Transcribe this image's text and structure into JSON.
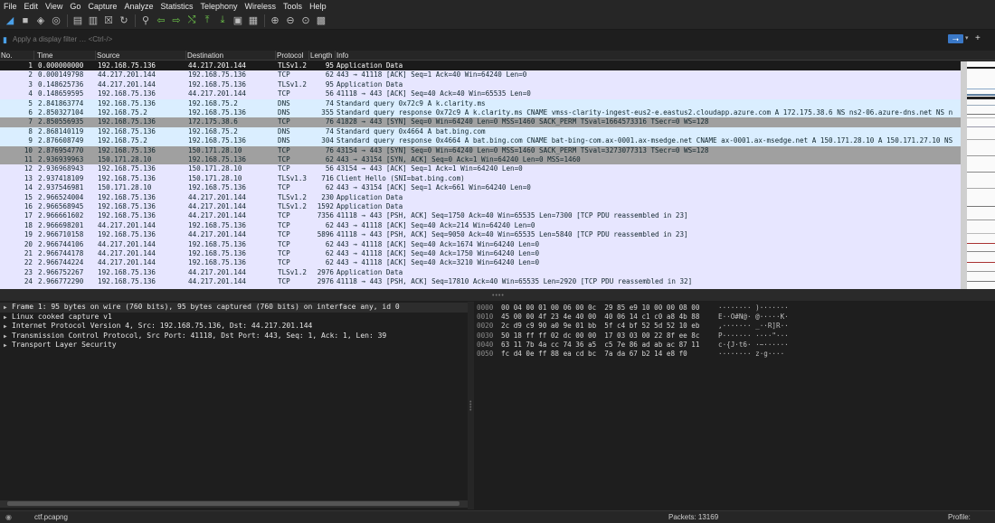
{
  "menu": [
    "File",
    "Edit",
    "View",
    "Go",
    "Capture",
    "Analyze",
    "Statistics",
    "Telephony",
    "Wireless",
    "Tools",
    "Help"
  ],
  "toolbar_icons": [
    "shark-fin-start-icon",
    "stop-icon",
    "restart-icon",
    "options-gear-icon",
    "open-file-icon",
    "save-file-icon",
    "close-file-icon",
    "reload-icon",
    "find-icon",
    "go-back-icon",
    "go-forward-icon",
    "go-to-packet-icon",
    "go-first-icon",
    "go-last-icon",
    "autoscroll-icon",
    "colorize-icon",
    "zoom-in-icon",
    "zoom-out-icon",
    "zoom-normal-icon",
    "resize-columns-icon"
  ],
  "filter": {
    "placeholder": "Apply a display filter … <Ctrl-/>",
    "apply_symbol": "⭢",
    "dropdown_symbol": "▾",
    "plus_symbol": "+"
  },
  "columns": [
    "No.",
    "Time",
    "Source",
    "Destination",
    "Protocol",
    "Length",
    "Info"
  ],
  "packets": [
    {
      "no": "1",
      "time": "0.000000000",
      "src": "192.168.75.136",
      "dst": "44.217.201.144",
      "proto": "TLSv1.2",
      "len": "95",
      "info": "Application Data",
      "style": "sel"
    },
    {
      "no": "2",
      "time": "0.000149798",
      "src": "44.217.201.144",
      "dst": "192.168.75.136",
      "proto": "TCP",
      "len": "62",
      "info": "443 → 41118 [ACK] Seq=1 Ack=40 Win=64240 Len=0",
      "style": "def"
    },
    {
      "no": "3",
      "time": "0.148625736",
      "src": "44.217.201.144",
      "dst": "192.168.75.136",
      "proto": "TLSv1.2",
      "len": "95",
      "info": "Application Data",
      "style": "def"
    },
    {
      "no": "4",
      "time": "0.148659595",
      "src": "192.168.75.136",
      "dst": "44.217.201.144",
      "proto": "TCP",
      "len": "56",
      "info": "41118 → 443 [ACK] Seq=40 Ack=40 Win=65535 Len=0",
      "style": "def"
    },
    {
      "no": "5",
      "time": "2.841863774",
      "src": "192.168.75.136",
      "dst": "192.168.75.2",
      "proto": "DNS",
      "len": "74",
      "info": "Standard query 0x72c9 A k.clarity.ms",
      "style": "ltblue"
    },
    {
      "no": "6",
      "time": "2.850327104",
      "src": "192.168.75.2",
      "dst": "192.168.75.136",
      "proto": "DNS",
      "len": "355",
      "info": "Standard query response 0x72c9 A k.clarity.ms CNAME vmss-clarity-ingest-eus2-e.eastus2.cloudapp.azure.com A 172.175.38.6 NS ns2-06.azure-dns.net NS n",
      "style": "ltblue"
    },
    {
      "no": "7",
      "time": "2.850556935",
      "src": "192.168.75.136",
      "dst": "172.175.38.6",
      "proto": "TCP",
      "len": "76",
      "info": "41828 → 443 [SYN] Seq=0 Win=64240 Len=0 MSS=1460 SACK_PERM TSval=1664573316 TSecr=0 WS=128",
      "style": "gray"
    },
    {
      "no": "8",
      "time": "2.868140119",
      "src": "192.168.75.136",
      "dst": "192.168.75.2",
      "proto": "DNS",
      "len": "74",
      "info": "Standard query 0x4664 A bat.bing.com",
      "style": "ltblue"
    },
    {
      "no": "9",
      "time": "2.876608749",
      "src": "192.168.75.2",
      "dst": "192.168.75.136",
      "proto": "DNS",
      "len": "304",
      "info": "Standard query response 0x4664 A bat.bing.com CNAME bat-bing-com.ax-0001.ax-msedge.net CNAME ax-0001.ax-msedge.net A 150.171.28.10 A 150.171.27.10 NS",
      "style": "ltblue"
    },
    {
      "no": "10",
      "time": "2.876954770",
      "src": "192.168.75.136",
      "dst": "150.171.28.10",
      "proto": "TCP",
      "len": "76",
      "info": "43154 → 443 [SYN] Seq=0 Win=64240 Len=0 MSS=1460 SACK_PERM TSval=3273077313 TSecr=0 WS=128",
      "style": "gray"
    },
    {
      "no": "11",
      "time": "2.936939963",
      "src": "150.171.28.10",
      "dst": "192.168.75.136",
      "proto": "TCP",
      "len": "62",
      "info": "443 → 43154 [SYN, ACK] Seq=0 Ack=1 Win=64240 Len=0 MSS=1460",
      "style": "gray"
    },
    {
      "no": "12",
      "time": "2.936968943",
      "src": "192.168.75.136",
      "dst": "150.171.28.10",
      "proto": "TCP",
      "len": "56",
      "info": "43154 → 443 [ACK] Seq=1 Ack=1 Win=64240 Len=0",
      "style": "def"
    },
    {
      "no": "13",
      "time": "2.937418109",
      "src": "192.168.75.136",
      "dst": "150.171.28.10",
      "proto": "TLSv1.3",
      "len": "716",
      "info": "Client Hello (SNI=bat.bing.com)",
      "style": "def"
    },
    {
      "no": "14",
      "time": "2.937546981",
      "src": "150.171.28.10",
      "dst": "192.168.75.136",
      "proto": "TCP",
      "len": "62",
      "info": "443 → 43154 [ACK] Seq=1 Ack=661 Win=64240 Len=0",
      "style": "def"
    },
    {
      "no": "15",
      "time": "2.966524004",
      "src": "192.168.75.136",
      "dst": "44.217.201.144",
      "proto": "TLSv1.2",
      "len": "230",
      "info": "Application Data",
      "style": "def"
    },
    {
      "no": "16",
      "time": "2.966568945",
      "src": "192.168.75.136",
      "dst": "44.217.201.144",
      "proto": "TLSv1.2",
      "len": "1592",
      "info": "Application Data",
      "style": "def"
    },
    {
      "no": "17",
      "time": "2.966661602",
      "src": "192.168.75.136",
      "dst": "44.217.201.144",
      "proto": "TCP",
      "len": "7356",
      "info": "41118 → 443 [PSH, ACK] Seq=1750 Ack=40 Win=65535 Len=7300 [TCP PDU reassembled in 23]",
      "style": "def"
    },
    {
      "no": "18",
      "time": "2.966698201",
      "src": "44.217.201.144",
      "dst": "192.168.75.136",
      "proto": "TCP",
      "len": "62",
      "info": "443 → 41118 [ACK] Seq=40 Ack=214 Win=64240 Len=0",
      "style": "def"
    },
    {
      "no": "19",
      "time": "2.966710158",
      "src": "192.168.75.136",
      "dst": "44.217.201.144",
      "proto": "TCP",
      "len": "5896",
      "info": "41118 → 443 [PSH, ACK] Seq=9050 Ack=40 Win=65535 Len=5840 [TCP PDU reassembled in 23]",
      "style": "def"
    },
    {
      "no": "20",
      "time": "2.966744106",
      "src": "44.217.201.144",
      "dst": "192.168.75.136",
      "proto": "TCP",
      "len": "62",
      "info": "443 → 41118 [ACK] Seq=40 Ack=1674 Win=64240 Len=0",
      "style": "def"
    },
    {
      "no": "21",
      "time": "2.966744178",
      "src": "44.217.201.144",
      "dst": "192.168.75.136",
      "proto": "TCP",
      "len": "62",
      "info": "443 → 41118 [ACK] Seq=40 Ack=1750 Win=64240 Len=0",
      "style": "def"
    },
    {
      "no": "22",
      "time": "2.966744224",
      "src": "44.217.201.144",
      "dst": "192.168.75.136",
      "proto": "TCP",
      "len": "62",
      "info": "443 → 41118 [ACK] Seq=40 Ack=3210 Win=64240 Len=0",
      "style": "def"
    },
    {
      "no": "23",
      "time": "2.966752267",
      "src": "192.168.75.136",
      "dst": "44.217.201.144",
      "proto": "TLSv1.2",
      "len": "2976",
      "info": "Application Data",
      "style": "def"
    },
    {
      "no": "24",
      "time": "2.966772290",
      "src": "192.168.75.136",
      "dst": "44.217.201.144",
      "proto": "TCP",
      "len": "2976",
      "info": "41118 → 443 [PSH, ACK] Seq=17810 Ack=40 Win=65535 Len=2920 [TCP PDU reassembled in 32]",
      "style": "def"
    }
  ],
  "details": [
    "Frame 1: 95 bytes on wire (760 bits), 95 bytes captured (760 bits) on interface any, id 0",
    "Linux cooked capture v1",
    "Internet Protocol Version 4, Src: 192.168.75.136, Dst: 44.217.201.144",
    "Transmission Control Protocol, Src Port: 41118, Dst Port: 443, Seq: 1, Ack: 1, Len: 39",
    "Transport Layer Security"
  ],
  "hex": [
    {
      "off": "0000",
      "bytes": "00 04 00 01 00 06 00 0c  29 85 e9 10 00 00 08 00",
      "ascii": "········ )·······"
    },
    {
      "off": "0010",
      "bytes": "45 00 00 4f 23 4e 40 00  40 06 14 c1 c0 a8 4b 88",
      "ascii": "E··O#N@· @·····K·"
    },
    {
      "off": "0020",
      "bytes": "2c d9 c9 90 a0 9e 01 bb  5f c4 bf 52 5d 52 10 eb",
      "ascii": ",······· _··R]R··"
    },
    {
      "off": "0030",
      "bytes": "50 18 ff ff 02 dc 00 00  17 03 03 00 22 8f ee 8c",
      "ascii": "P······· ····\"···"
    },
    {
      "off": "0040",
      "bytes": "63 11 7b 4a cc 74 36 a5  c5 7e 86 ad ab ac 87 11",
      "ascii": "c·{J·t6· ·~······"
    },
    {
      "off": "0050",
      "bytes": "fc d4 0e ff 88 ea cd bc  7a da 67 b2 14 e8 f0",
      "ascii": "········ z·g····"
    }
  ],
  "status": {
    "file": "ctf.pcapng",
    "packets": "Packets: 13169",
    "profile": "Profile: Default"
  },
  "colors": {
    "selected_row": "#1b1b1b",
    "tcp_syn_row": "#a0a0a0",
    "dns_row": "#daeeff",
    "default_row": "#e7e6ff",
    "background": "#1e1e1e"
  }
}
